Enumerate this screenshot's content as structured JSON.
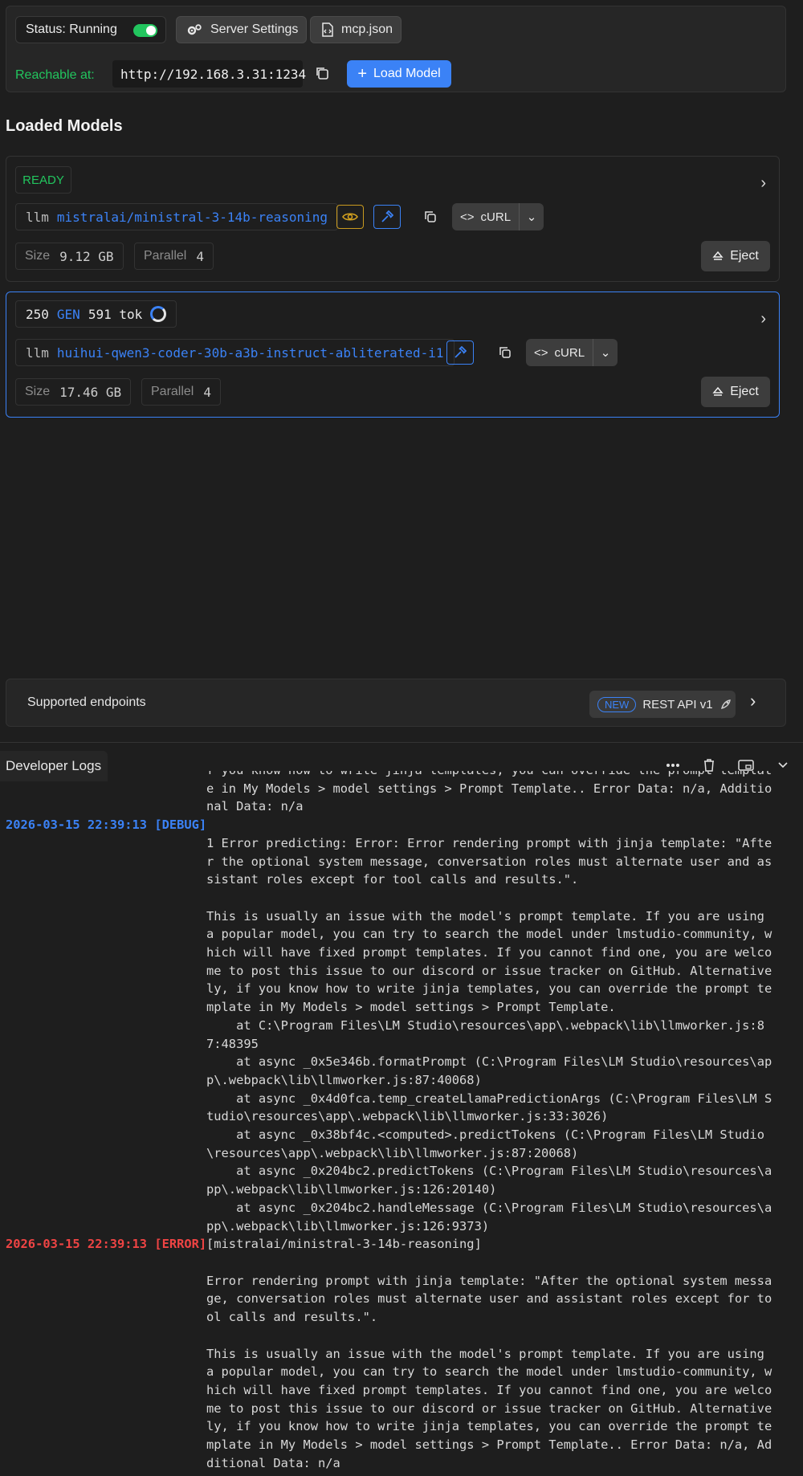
{
  "server": {
    "status_label": "Status: Running",
    "server_settings_label": "Server Settings",
    "mcp_label": "mcp.json",
    "reachable_label": "Reachable at:",
    "url": "http://192.168.3.31:1234",
    "load_model_label": "Load Model"
  },
  "loaded_models_title": "Loaded Models",
  "models": [
    {
      "badge": "READY",
      "kind": "llm",
      "name": "mistralai/ministral-3-14b-reasoning",
      "curl_label": "cURL",
      "size_label": "Size",
      "size_value": "9.12 GB",
      "parallel_label": "Parallel",
      "parallel_value": "4",
      "eject_label": "Eject"
    },
    {
      "gen_prompt": "250",
      "gen_label": "GEN",
      "gen_tokens": "591 tok",
      "kind": "llm",
      "name": "huihui-qwen3-coder-30b-a3b-instruct-abliterated-i1",
      "curl_label": "cURL",
      "size_label": "Size",
      "size_value": "17.46 GB",
      "parallel_label": "Parallel",
      "parallel_value": "4",
      "eject_label": "Eject"
    }
  ],
  "endpoints": {
    "label": "Supported endpoints",
    "new_badge": "NEW",
    "rest_label": "REST API v1"
  },
  "logs_tab": "Developer Logs",
  "logs": [
    {
      "ts": "",
      "level": "blank",
      "msg": "f you know how to write jinja templates, you can override the prompt template in My Models > model settings > Prompt Template.. Error Data: n/a, Additional Data: n/a"
    },
    {
      "ts": "2026-03-15 22:39:13 [DEBUG]",
      "level": "debug",
      "msg": ""
    },
    {
      "ts": "",
      "level": "blank",
      "msg": "1 Error predicting: Error: Error rendering prompt with jinja template: \"After the optional system message, conversation roles must alternate user and assistant roles except for tool calls and results.\".\n\nThis is usually an issue with the model's prompt template. If you are using a popular model, you can try to search the model under lmstudio-community, which will have fixed prompt templates. If you cannot find one, you are welcome to post this issue to our discord or issue tracker on GitHub. Alternatively, if you know how to write jinja templates, you can override the prompt template in My Models > model settings > Prompt Template.\n    at C:\\Program Files\\LM Studio\\resources\\app\\.webpack\\lib\\llmworker.js:87:48395\n    at async _0x5e346b.formatPrompt (C:\\Program Files\\LM Studio\\resources\\app\\.webpack\\lib\\llmworker.js:87:40068)\n    at async _0x4d0fca.temp_createLlamaPredictionArgs (C:\\Program Files\\LM Studio\\resources\\app\\.webpack\\lib\\llmworker.js:33:3026)\n    at async _0x38bf4c.<computed>.predictTokens (C:\\Program Files\\LM Studio\\resources\\app\\.webpack\\lib\\llmworker.js:87:20068)\n    at async _0x204bc2.predictTokens (C:\\Program Files\\LM Studio\\resources\\app\\.webpack\\lib\\llmworker.js:126:20140)\n    at async _0x204bc2.handleMessage (C:\\Program Files\\LM Studio\\resources\\app\\.webpack\\lib\\llmworker.js:126:9373)"
    },
    {
      "ts": "2026-03-15 22:39:13 [ERROR]",
      "level": "error",
      "msg": "[mistralai/ministral-3-14b-reasoning]\n\nError rendering prompt with jinja template: \"After the optional system message, conversation roles must alternate user and assistant roles except for tool calls and results.\".\n\nThis is usually an issue with the model's prompt template. If you are using a popular model, you can try to search the model under lmstudio-community, which will have fixed prompt templates. If you cannot find one, you are welcome to post this issue to our discord or issue tracker on GitHub. Alternatively, if you know how to write jinja templates, you can override the prompt template in My Models > model settings > Prompt Template.. Error Data: n/a, Additional Data: n/a"
    }
  ]
}
